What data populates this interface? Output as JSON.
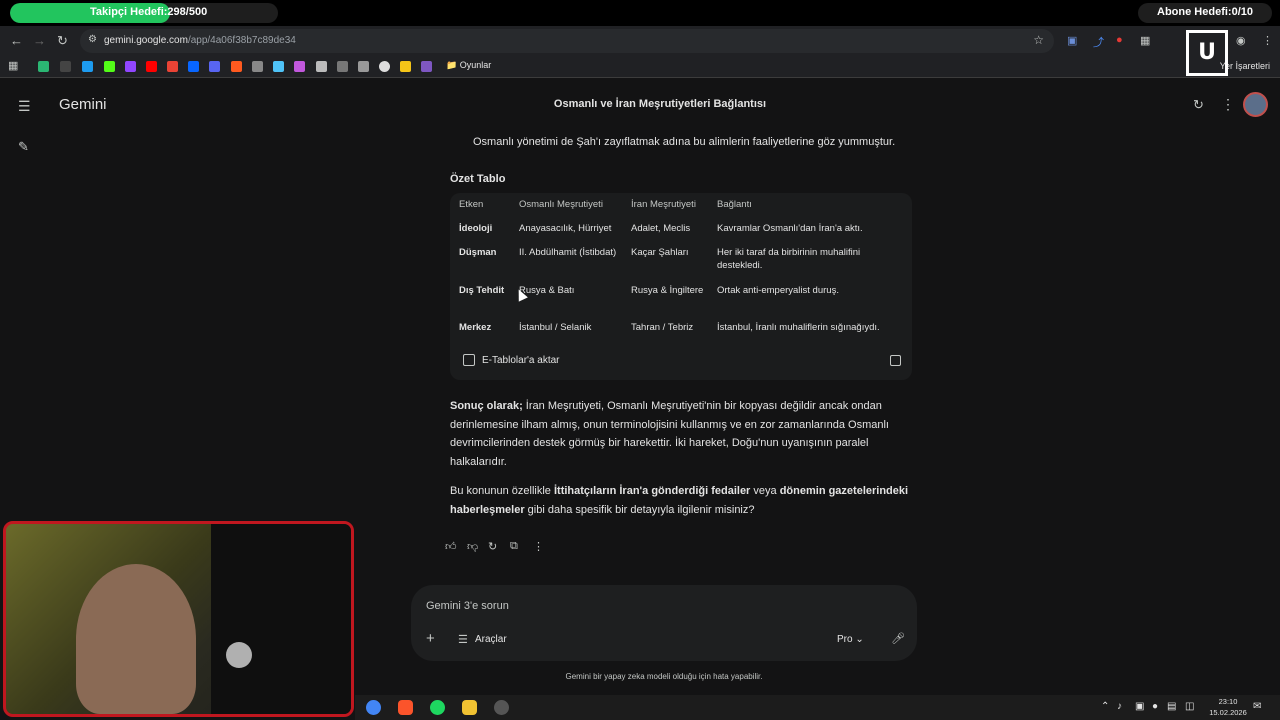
{
  "overlay": {
    "follower_goal": "Takipçi Hedefi:298/500",
    "follower_progress": 0.596,
    "subscriber_goal": "Abone Hedefi:0/10"
  },
  "browser": {
    "url_host": "gemini.google.com",
    "url_path": "/app/4a06f38b7c89de34",
    "bookmark_folder": "Oyunlar",
    "bookmarks_right": "Yer İşaretleri"
  },
  "app": {
    "brand": "Gemini",
    "title": "Osmanlı ve İran Meşrutiyetleri Bağlantısı"
  },
  "response": {
    "lead_text": "Osmanlı yönetimi de Şah'ı zayıflatmak adına bu alimlerin faaliyetlerine göz yummuştur.",
    "table_heading": "Özet Tablo",
    "table_headers": [
      "Etken",
      "Osmanlı Meşrutiyeti",
      "İran Meşrutiyeti",
      "Bağlantı"
    ],
    "table_rows": [
      [
        "İdeoloji",
        "Anayasacılık, Hürriyet",
        "Adalet, Meclis",
        "Kavramlar Osmanlı'dan İran'a aktı."
      ],
      [
        "Düşman",
        "II. Abdülhamit (İstibdat)",
        "Kaçar Şahları",
        "Her iki taraf da birbirinin muhalifini destekledi."
      ],
      [
        "Dış Tehdit",
        "Rusya & Batı",
        "Rusya & İngiltere",
        "Ortak anti-emperyalist duruş."
      ],
      [
        "Merkez",
        "İstanbul / Selanik",
        "Tahran / Tebriz",
        "İstanbul, İranlı muhaliflerin sığınağıydı."
      ]
    ],
    "export_label": "E-Tablolar'a aktar",
    "conclusion_bold": "Sonuç olarak;",
    "conclusion_text": " İran Meşrutiyeti, Osmanlı Meşrutiyeti'nin bir kopyası değildir ancak ondan derinlemesine ilham almış, onun terminolojisini kullanmış ve en zor zamanlarında Osmanlı devrimcilerinden destek görmüş bir harekettir. İki hareket, Doğu'nun uyanışının paralel halkalarıdır.",
    "followup_1": "Bu konunun özellikle ",
    "followup_b1": "İttihatçıların İran'a gönderdiği fedailer",
    "followup_2": " veya ",
    "followup_b2": "dönemin gazetelerindeki haberleşmeler",
    "followup_3": " gibi daha spesifik bir detayıyla ilgilenir misiniz?"
  },
  "composer": {
    "placeholder": "Gemini 3'e sorun",
    "tools_label": "Araçlar",
    "model_label": "Pro",
    "disclaimer": "Gemini bir yapay zeka modeli olduğu için hata yapabilir."
  },
  "taskbar": {
    "time": "23:10",
    "date": "15.02.2026"
  },
  "icons": [
    "menu-icon",
    "edit-icon",
    "share-icon",
    "more-vert-icon",
    "thumbs-up-icon",
    "thumbs-down-icon",
    "refresh-icon",
    "copy-icon",
    "more-horiz-icon",
    "plus-icon",
    "tools-icon",
    "chevron-down-icon",
    "mic-icon",
    "table-icon"
  ]
}
